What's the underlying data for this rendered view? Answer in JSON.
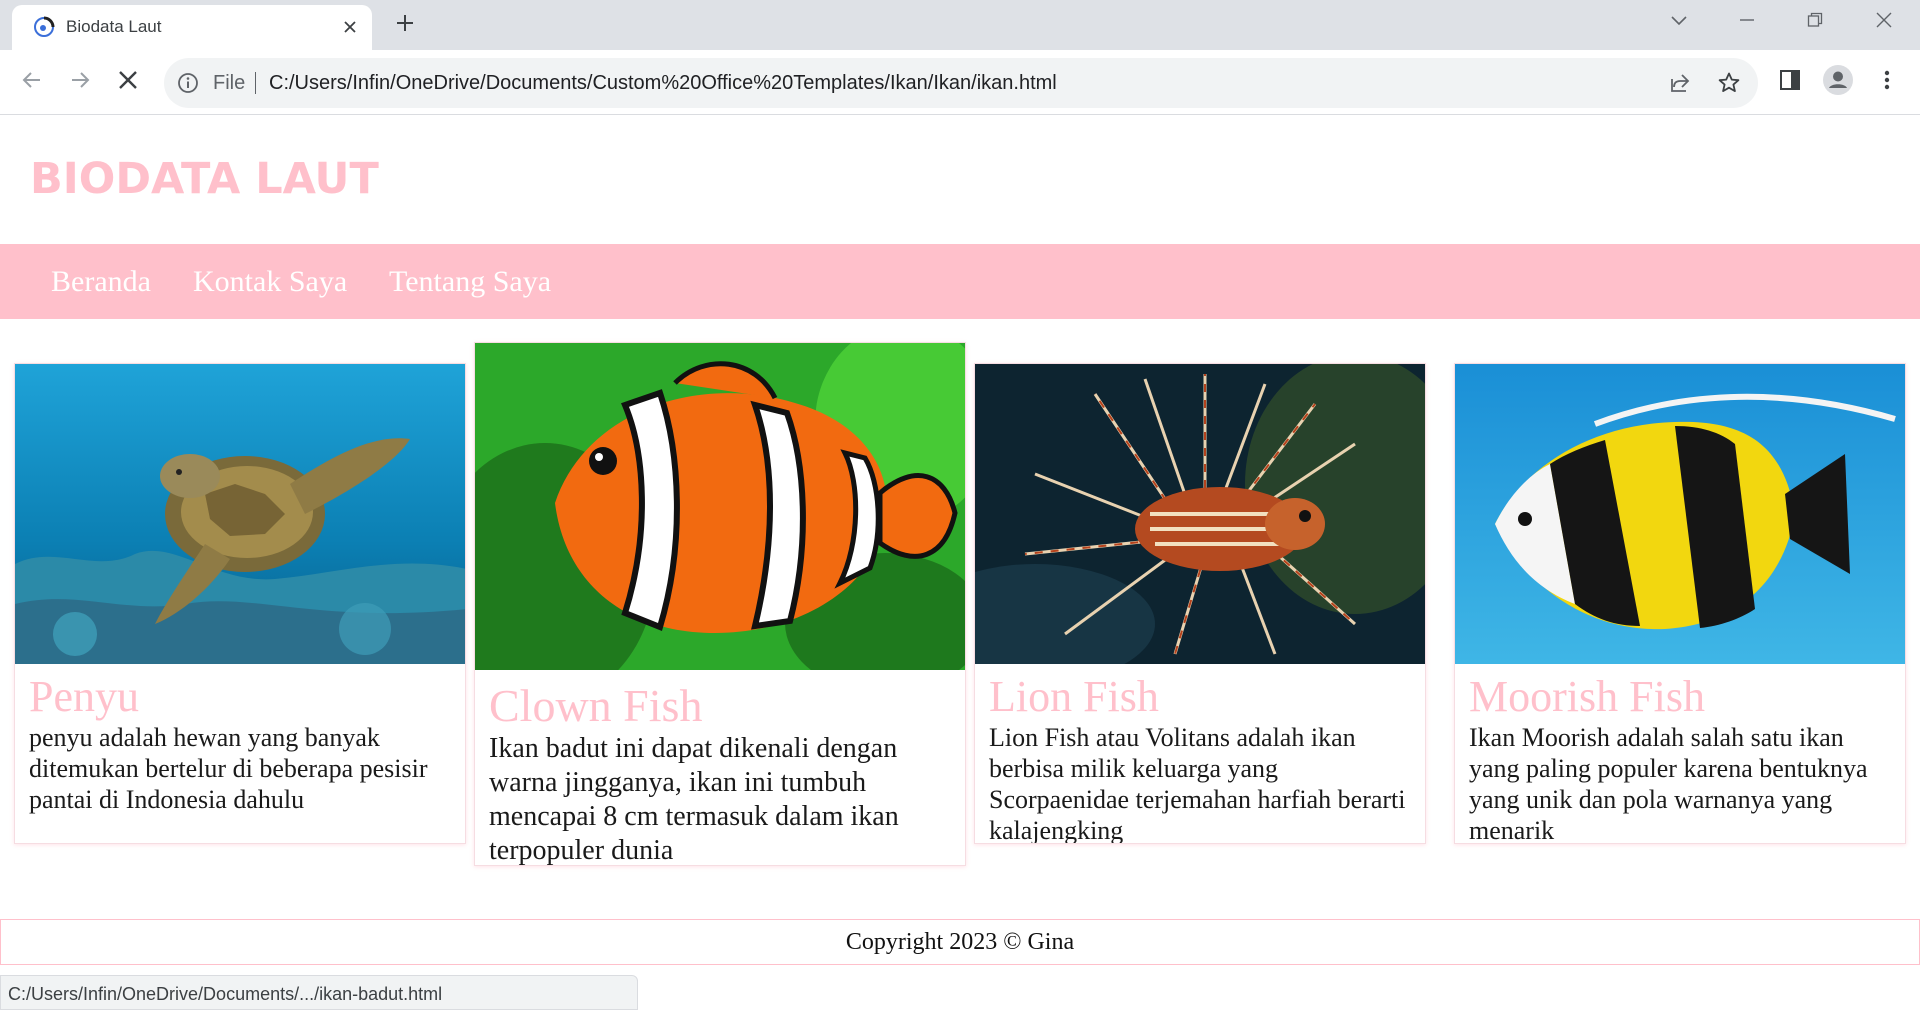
{
  "browser": {
    "tab_title": "Biodata Laut",
    "scheme_label": "File",
    "url": "C:/Users/Infin/OneDrive/Documents/Custom%20Office%20Templates/Ikan/Ikan/ikan.html",
    "status_url": "C:/Users/Infin/OneDrive/Documents/.../ikan-badut.html"
  },
  "site": {
    "title": "BIODATA LAUT",
    "nav": [
      "Beranda",
      "Kontak Saya",
      "Tentang Saya"
    ]
  },
  "cards": [
    {
      "title": "Penyu",
      "text": "penyu adalah hewan yang banyak ditemukan bertelur di beberapa pesisir pantai di Indonesia dahulu"
    },
    {
      "title": "Clown Fish",
      "text": "Ikan badut ini dapat dikenali dengan warna jingganya, ikan ini tumbuh mencapai 8 cm termasuk dalam ikan terpopuler dunia"
    },
    {
      "title": "Lion Fish",
      "text": "Lion Fish atau Volitans adalah ikan berbisa milik keluarga yang Scorpaenidae terjemahan harfiah berarti kalajengking"
    },
    {
      "title": "Moorish Fish",
      "text": "Ikan Moorish adalah salah satu ikan yang paling populer karena bentuknya yang unik dan pola warnanya yang menarik"
    }
  ],
  "footer": {
    "text": "Copyright 2023 © Gina"
  },
  "colors": {
    "accent_pink": "#ffc0cb",
    "chrome_bg": "#dee1e6",
    "omnibox_bg": "#f1f3f4"
  },
  "icons": {
    "tab": "site-favicon-icon",
    "close": "close-icon",
    "new_tab": "plus-icon",
    "back": "back-arrow-icon",
    "forward": "forward-arrow-icon",
    "stop": "stop-loading-icon",
    "info": "info-icon",
    "share": "share-icon",
    "bookmark": "star-icon",
    "side_panel": "side-panel-icon",
    "profile": "profile-icon",
    "menu": "kebab-menu-icon"
  }
}
